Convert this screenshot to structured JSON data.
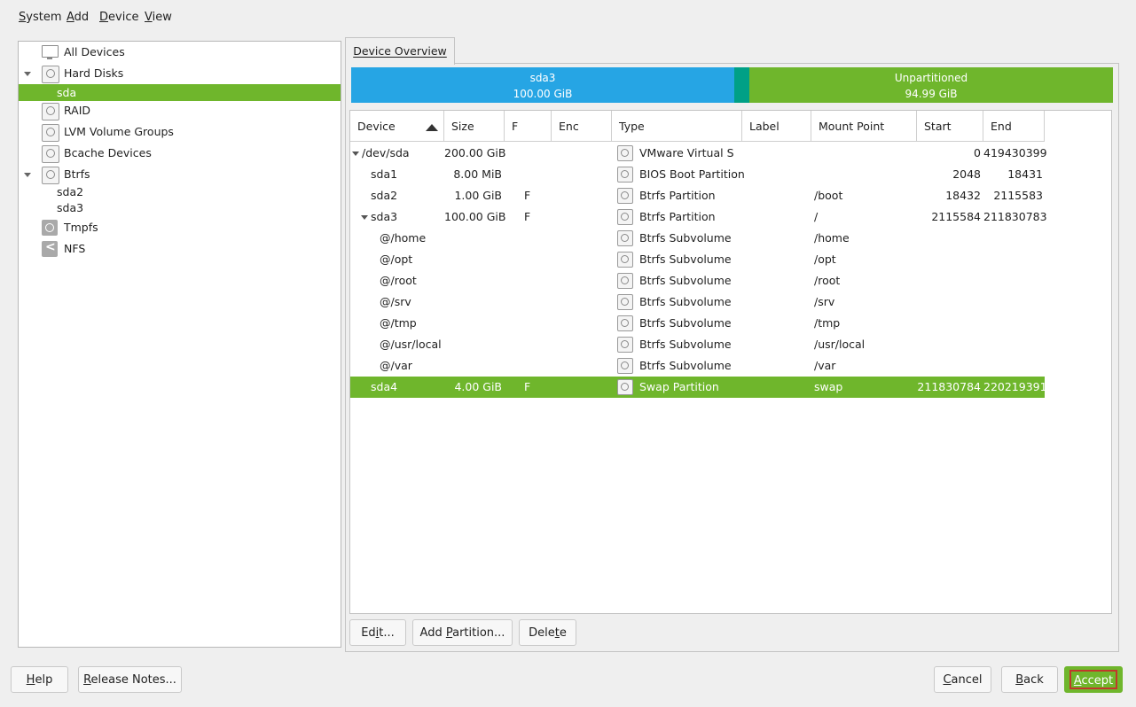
{
  "menu": [
    {
      "label": "System",
      "mn": "S",
      "rest": "ystem"
    },
    {
      "label": "Add",
      "mn": "A",
      "rest": "dd"
    },
    {
      "label": "Device",
      "mn": "D",
      "rest": "evice"
    },
    {
      "label": "View",
      "mn": "V",
      "rest": "iew"
    }
  ],
  "tree": {
    "items": [
      {
        "label": "All Devices"
      },
      {
        "label": "Hard Disks"
      },
      {
        "label": "sda"
      },
      {
        "label": "RAID"
      },
      {
        "label": "LVM Volume Groups"
      },
      {
        "label": "Bcache Devices"
      },
      {
        "label": "Btrfs"
      },
      {
        "label": "sda2"
      },
      {
        "label": "sda3"
      },
      {
        "label": "Tmpfs"
      },
      {
        "label": "NFS"
      }
    ]
  },
  "tab": {
    "label": "Device Overview"
  },
  "diskbar": {
    "sda3": {
      "name": "sda3",
      "size": "100.00 GiB"
    },
    "unpartitioned": {
      "name": "Unpartitioned",
      "size": "94.99 GiB"
    }
  },
  "table": {
    "headers": [
      "Device",
      "Size",
      "F",
      "Enc",
      "Type",
      "Label",
      "Mount Point",
      "Start",
      "End"
    ],
    "rows": [
      {
        "device": "/dev/sda",
        "size": "200.00 GiB",
        "f": "",
        "type": "VMware Virtual S",
        "mount": "",
        "start": "0",
        "end": "419430399"
      },
      {
        "device": "sda1",
        "size": "8.00 MiB",
        "f": "",
        "type": "BIOS Boot Partition",
        "mount": "",
        "start": "2048",
        "end": "18431"
      },
      {
        "device": "sda2",
        "size": "1.00 GiB",
        "f": "F",
        "type": "Btrfs Partition",
        "mount": "/boot",
        "start": "18432",
        "end": "2115583"
      },
      {
        "device": "sda3",
        "size": "100.00 GiB",
        "f": "F",
        "type": "Btrfs Partition",
        "mount": "/",
        "start": "2115584",
        "end": "211830783"
      },
      {
        "device": "@/home",
        "size": "",
        "f": "",
        "type": "Btrfs Subvolume",
        "mount": "/home",
        "start": "",
        "end": ""
      },
      {
        "device": "@/opt",
        "size": "",
        "f": "",
        "type": "Btrfs Subvolume",
        "mount": "/opt",
        "start": "",
        "end": ""
      },
      {
        "device": "@/root",
        "size": "",
        "f": "",
        "type": "Btrfs Subvolume",
        "mount": "/root",
        "start": "",
        "end": ""
      },
      {
        "device": "@/srv",
        "size": "",
        "f": "",
        "type": "Btrfs Subvolume",
        "mount": "/srv",
        "start": "",
        "end": ""
      },
      {
        "device": "@/tmp",
        "size": "",
        "f": "",
        "type": "Btrfs Subvolume",
        "mount": "/tmp",
        "start": "",
        "end": ""
      },
      {
        "device": "@/usr/local",
        "size": "",
        "f": "",
        "type": "Btrfs Subvolume",
        "mount": "/usr/local",
        "start": "",
        "end": ""
      },
      {
        "device": "@/var",
        "size": "",
        "f": "",
        "type": "Btrfs Subvolume",
        "mount": "/var",
        "start": "",
        "end": ""
      },
      {
        "device": "sda4",
        "size": "4.00 GiB",
        "f": "F",
        "type": "Swap Partition",
        "mount": "swap",
        "start": "211830784",
        "end": "220219391"
      }
    ]
  },
  "actions": {
    "edit": {
      "pre": "Ed",
      "mn": "i",
      "post": "t..."
    },
    "add_partition": {
      "pre": "Add ",
      "mn": "P",
      "post": "artition..."
    },
    "delete": {
      "pre": "Dele",
      "mn": "t",
      "post": "e"
    }
  },
  "footer": {
    "help": {
      "pre": "",
      "mn": "H",
      "post": "elp"
    },
    "release_notes": {
      "pre": "",
      "mn": "R",
      "post": "elease Notes..."
    },
    "cancel": {
      "pre": "",
      "mn": "C",
      "post": "ancel"
    },
    "back": {
      "pre": "",
      "mn": "B",
      "post": "ack"
    },
    "accept": {
      "pre": "",
      "mn": "A",
      "post": "ccept"
    }
  },
  "colors": {
    "accent": "#6fb62c",
    "bar_blue": "#26a5e4",
    "bar_teal": "#00a086"
  }
}
